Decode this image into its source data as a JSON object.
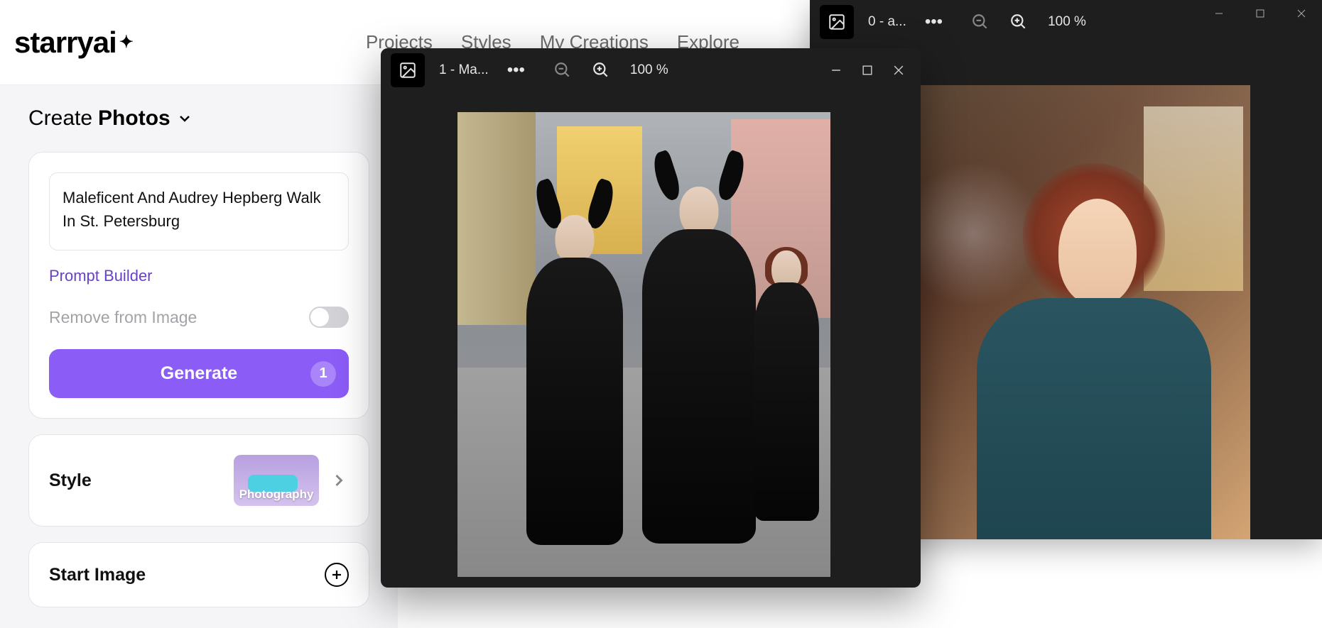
{
  "app": {
    "logo": "starryai"
  },
  "nav": {
    "projects": "Projects",
    "styles": "Styles",
    "mycreations": "My Creations",
    "explore": "Explore"
  },
  "sidebar": {
    "create_label": "Create",
    "create_subject": "Photos",
    "prompt_value": "Maleficent And Audrey Hepberg Walk In St. Petersburg",
    "prompt_builder": "Prompt Builder",
    "remove_label": "Remove from Image",
    "generate_label": "Generate",
    "generate_count": "1",
    "style_label": "Style",
    "style_value": "Photography",
    "start_image_label": "Start Image"
  },
  "viewer1": {
    "title": "1 - Ma...",
    "zoom": "100 %"
  },
  "viewer2": {
    "title": "0 - a...",
    "zoom": "100 %"
  }
}
